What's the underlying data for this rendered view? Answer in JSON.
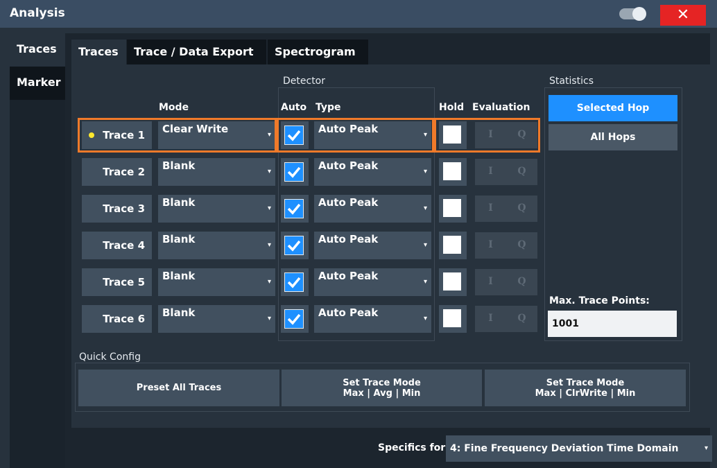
{
  "window": {
    "title": "Analysis",
    "close_glyph": "✕"
  },
  "side_tabs": [
    {
      "label": "Traces"
    },
    {
      "label": "Marker"
    }
  ],
  "top_tabs": [
    {
      "label": "Traces"
    },
    {
      "label": "Trace / Data Export"
    },
    {
      "label": "Spectrogram"
    }
  ],
  "traces": {
    "detector_group": "Detector",
    "headers": {
      "mode": "Mode",
      "auto": "Auto",
      "type": "Type",
      "hold": "Hold",
      "evaluation": "Evaluation"
    },
    "rows": [
      {
        "name": "Trace 1",
        "mode": "Clear Write",
        "auto": true,
        "type": "Auto Peak",
        "hold": false,
        "eval_i": "I",
        "eval_q": "Q",
        "selected": true
      },
      {
        "name": "Trace 2",
        "mode": "Blank",
        "auto": true,
        "type": "Auto Peak",
        "hold": false,
        "eval_i": "I",
        "eval_q": "Q"
      },
      {
        "name": "Trace 3",
        "mode": "Blank",
        "auto": true,
        "type": "Auto Peak",
        "hold": false,
        "eval_i": "I",
        "eval_q": "Q"
      },
      {
        "name": "Trace 4",
        "mode": "Blank",
        "auto": true,
        "type": "Auto Peak",
        "hold": false,
        "eval_i": "I",
        "eval_q": "Q"
      },
      {
        "name": "Trace 5",
        "mode": "Blank",
        "auto": true,
        "type": "Auto Peak",
        "hold": false,
        "eval_i": "I",
        "eval_q": "Q"
      },
      {
        "name": "Trace 6",
        "mode": "Blank",
        "auto": true,
        "type": "Auto Peak",
        "hold": false,
        "eval_i": "I",
        "eval_q": "Q"
      }
    ]
  },
  "statistics": {
    "label": "Statistics",
    "selected_hop": "Selected Hop",
    "all_hops": "All Hops",
    "max_trace_points_label": "Max. Trace Points:",
    "max_trace_points_value": "1001"
  },
  "quick_config": {
    "label": "Quick Config",
    "preset_all": "Preset All Traces",
    "set_mode_1_line1": "Set Trace Mode",
    "set_mode_1_line2": "Max | Avg | Min",
    "set_mode_2_line1": "Set Trace Mode",
    "set_mode_2_line2": "Max | ClrWrite | Min"
  },
  "specifics": {
    "label": "Specifics for",
    "value": "4: Fine Frequency Deviation Time Domain"
  },
  "colors": {
    "accent_blue": "#1e90ff",
    "selection_orange": "#f07a2a",
    "close_red": "#e52424",
    "marker_yellow": "#ffe82e"
  }
}
